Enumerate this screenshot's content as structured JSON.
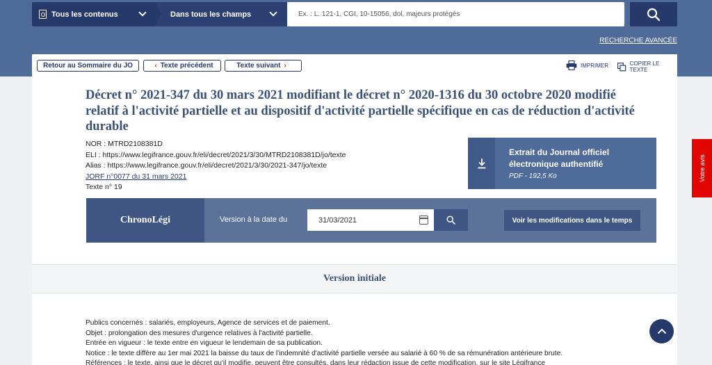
{
  "search": {
    "scope": "Tous les contenus",
    "field": "Dans tous les champs",
    "placeholder": "Ex. : L. 121-1, CGI, 10-15056, dol, majeurs protégés"
  },
  "header": {
    "advanced_search": "RECHERCHE AVANCÉE"
  },
  "nav": {
    "back": "Retour au Sommaire du JO",
    "prev": "Texte précédent",
    "next": "Texte suivant",
    "print": "IMPRIMER",
    "copy": "COPIER LE TEXTE"
  },
  "document": {
    "title": "Décret n° 2021-347 du 30 mars 2021 modifiant le décret n° 2020-1316 du 30 octobre 2020 modifié relatif à l'activité partielle et au dispositif d'activité partielle spécifique en cas de réduction d'activité durable",
    "nor": "NOR : MTRD2108381D",
    "eli": "ELI : https://www.legifrance.gouv.fr/eli/decret/2021/3/30/MTRD2108381D/jo/texte",
    "alias": "Alias : https://www.legifrance.gouv.fr/eli/decret/2021/3/30/2021-347/jo/texte",
    "jorf": "JORF n°0077 du 31 mars 2021",
    "texte": "Texte n° 19"
  },
  "jo_extract": {
    "title_line1": "Extrait du Journal officiel",
    "title_line2": "électronique authentifié",
    "subtitle": "PDF - 192,5 Ko"
  },
  "chrono": {
    "title": "ChronoLégi",
    "label": "Version à la date du",
    "date": "31/03/2021",
    "modif_button": "Voir les modifications dans le temps"
  },
  "version": {
    "label": "Version initiale"
  },
  "body": {
    "lines": [
      "Publics concernés : salariés, employeurs, Agence de services et de paiement.",
      "Objet : prolongation des mesures d'urgence relatives à l'activité partielle.",
      "Entrée en vigueur : le texte entre en vigueur le lendemain de sa publication.",
      "Notice : le texte diffère au 1er mai 2021 la baisse du taux de l'indemnité d'activité partielle versée au salarié à 60 % de sa rémunération antérieure brute.",
      "Références : le texte, ainsi que le décret qu'il modifie, peuvent être consultés, dans leur rédaction issue de cette modification, sur le site Légifrance"
    ]
  },
  "feedback": {
    "label": "Votre avis"
  },
  "colors": {
    "navy": "#26396b",
    "band": "#4f6b9a",
    "accent_red": "#e10600"
  }
}
